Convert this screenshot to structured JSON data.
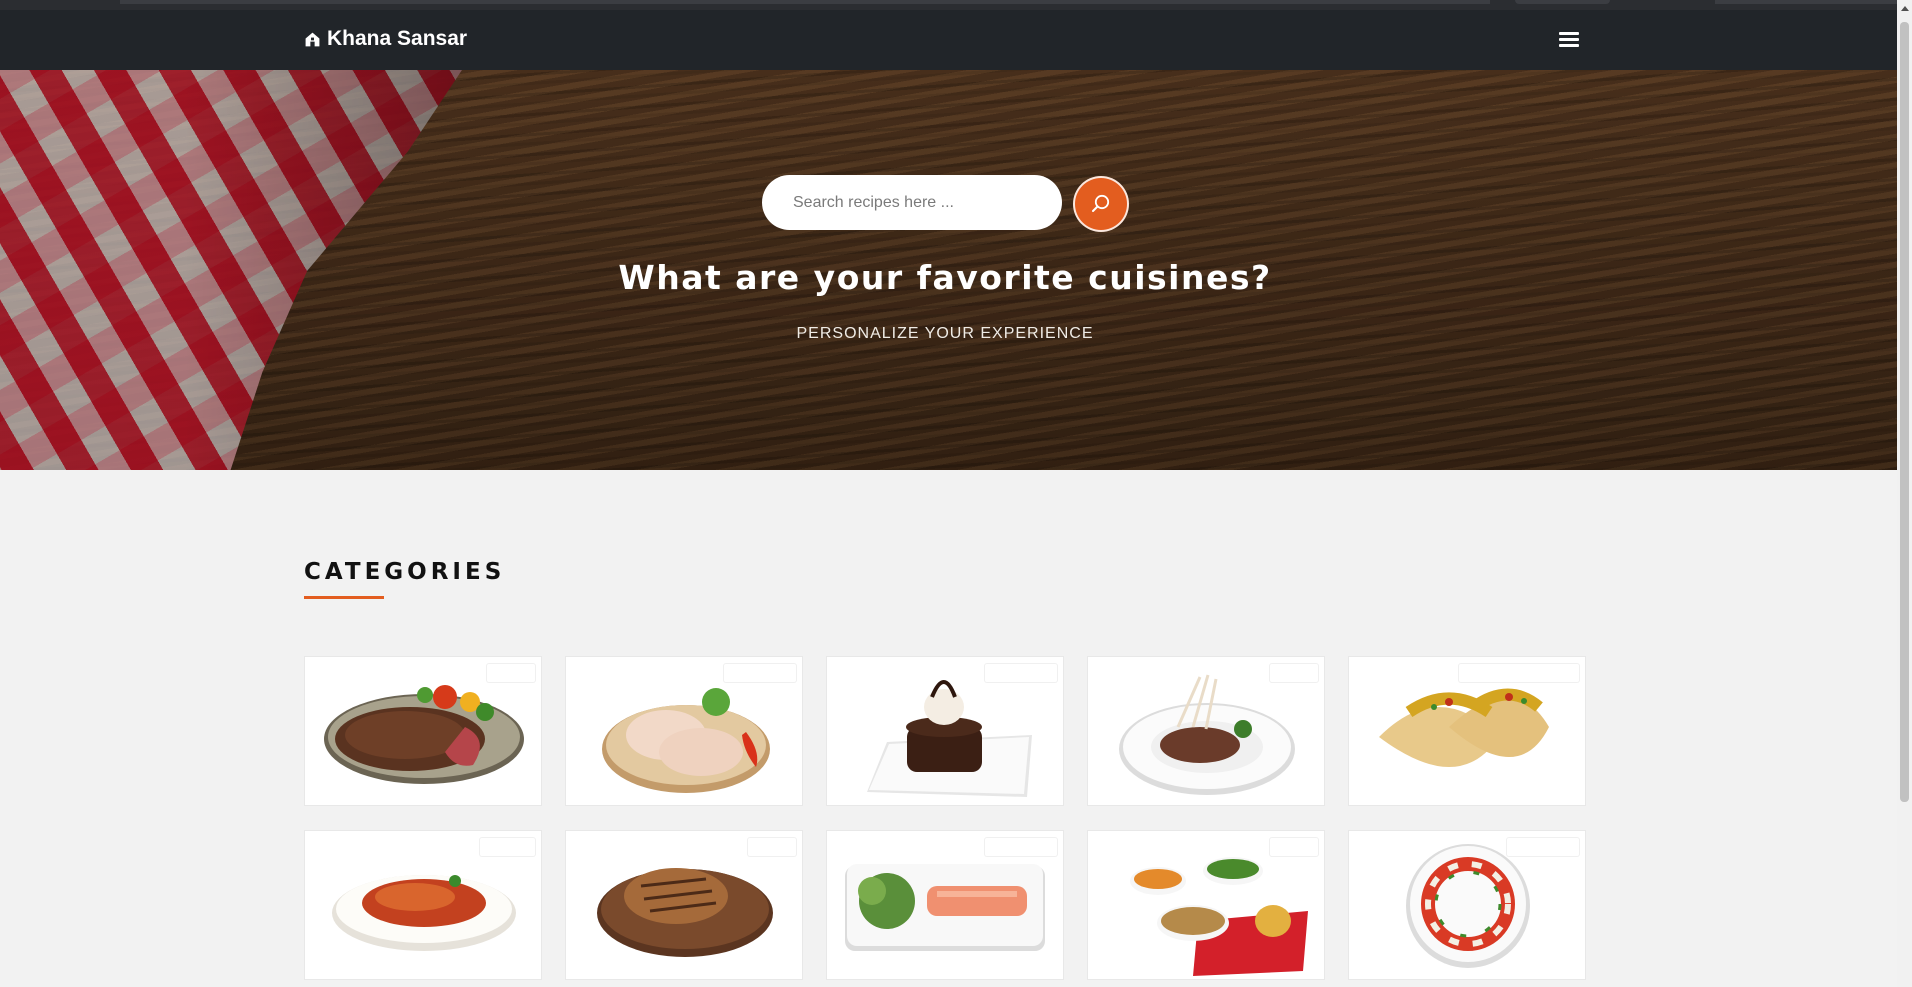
{
  "navbar": {
    "brand": "Khana Sansar",
    "brand_icon": "home-icon",
    "menu_icon": "hamburger-menu-icon"
  },
  "hero": {
    "search_placeholder": "Search recipes here ...",
    "search_icon": "search-icon",
    "title": "What are your favorite cuisines?",
    "subtitle": "PERSONALIZE YOUR EXPERIENCE"
  },
  "categories": {
    "heading": "CATEGORIES",
    "accent_color": "#e35d1f",
    "items": [
      {
        "image": "steak-with-vegetables-image"
      },
      {
        "image": "raw-chicken-legs-image"
      },
      {
        "image": "chocolate-lava-cake-image"
      },
      {
        "image": "lamb-chops-image"
      },
      {
        "image": "tacos-image"
      },
      {
        "image": "penne-pasta-image"
      },
      {
        "image": "grilled-pork-chop-image"
      },
      {
        "image": "salmon-carpaccio-image"
      },
      {
        "image": "side-dishes-bowls-image"
      },
      {
        "image": "caprese-salad-image"
      }
    ]
  }
}
